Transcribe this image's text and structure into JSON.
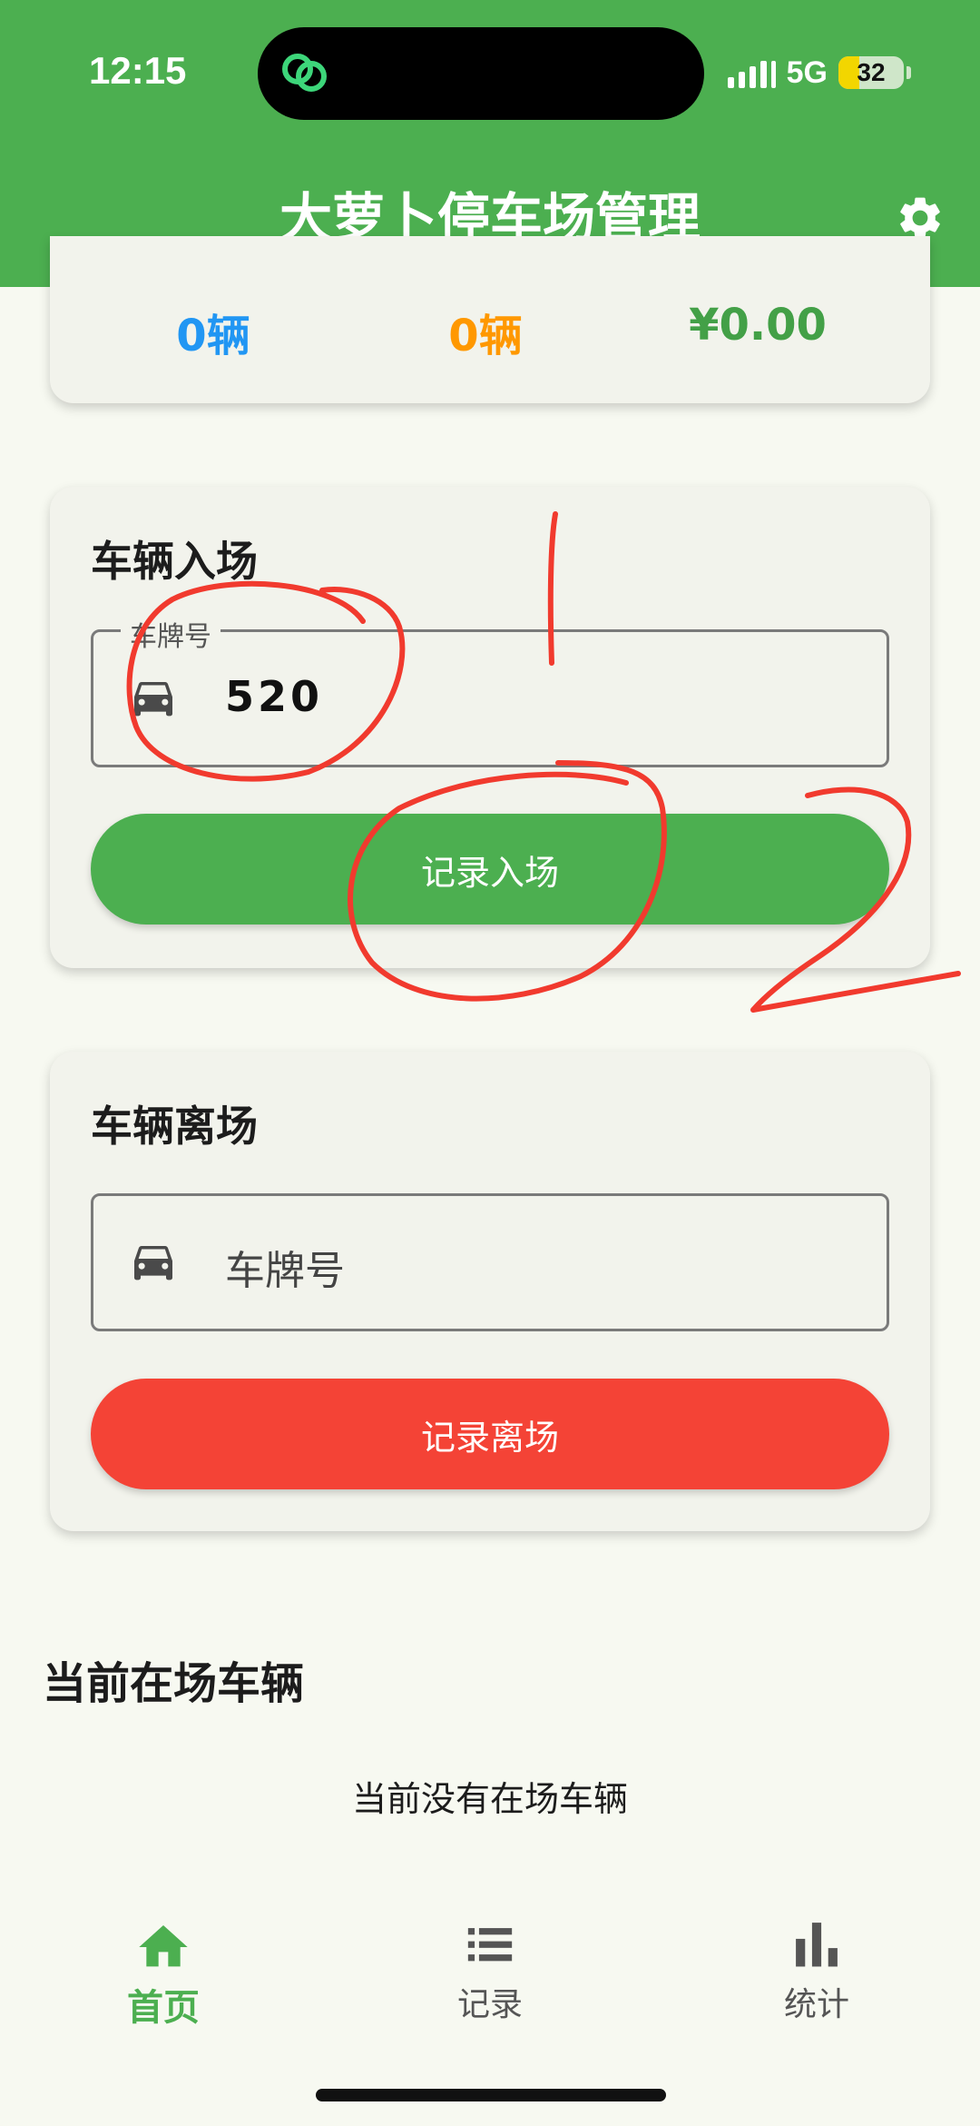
{
  "status_bar": {
    "time": "12:15",
    "network": "5G",
    "battery": "32",
    "battery_level": 0.32
  },
  "header": {
    "title": "大萝卜停车场管理",
    "settings_icon": "gear-icon",
    "color": "#4caf50"
  },
  "stats": {
    "values": [
      "0辆",
      "0辆",
      "¥0.00"
    ],
    "colors": [
      "#2196f3",
      "#ff9800",
      "#43a047"
    ]
  },
  "entry": {
    "title": "车辆入场",
    "field_label": "车牌号",
    "plate_value": "520",
    "button_label": "记录入场",
    "button_color": "#4caf50"
  },
  "exit": {
    "title": "车辆离场",
    "field_placeholder": "车牌号",
    "button_label": "记录离场",
    "button_color": "#f44336"
  },
  "current": {
    "title": "当前在场车辆",
    "empty_message": "当前没有在场车辆"
  },
  "bottom_nav": {
    "items": [
      {
        "label": "首页",
        "icon": "home-icon",
        "active": true
      },
      {
        "label": "记录",
        "icon": "list-icon",
        "active": false
      },
      {
        "label": "统计",
        "icon": "bar-chart-icon",
        "active": false
      }
    ]
  },
  "annotations": {
    "color": "#f13a2e",
    "digits": [
      "1",
      "2"
    ]
  }
}
